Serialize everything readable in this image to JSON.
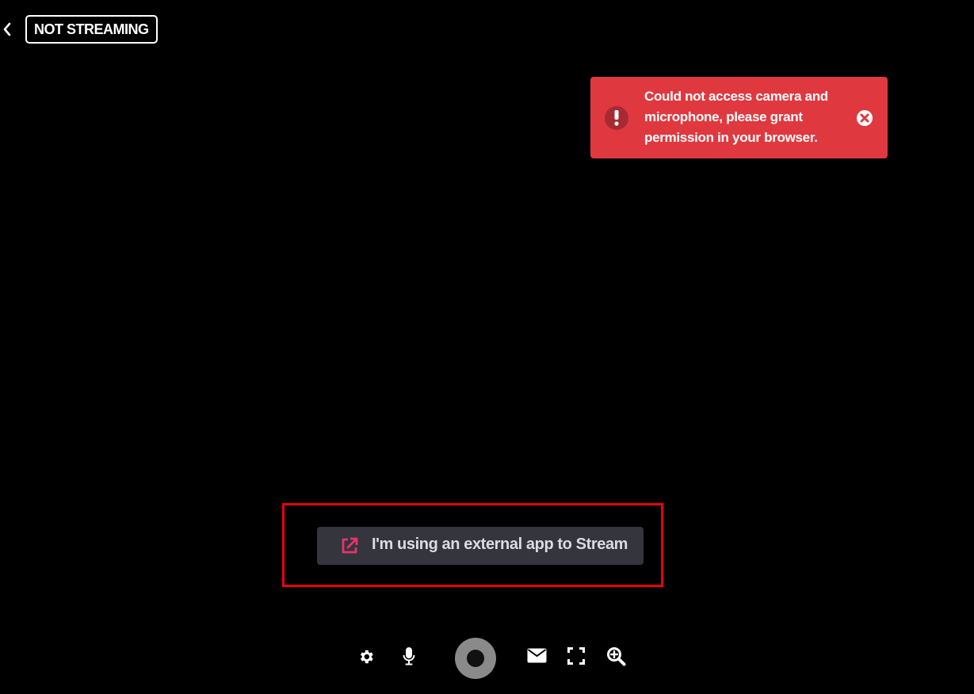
{
  "header": {
    "status_label": "NOT STREAMING",
    "back_icon": "chevron-left-icon"
  },
  "toast": {
    "message": "Could not access camera and microphone, please grant permission in your browser.",
    "background": "#e0383f",
    "icon": "exclamation-circle-icon",
    "close_icon": "close-circle-icon"
  },
  "external_app": {
    "label": "I'm using an external app to Stream",
    "icon": "external-link-icon",
    "icon_color": "#e8336e",
    "highlight_color": "#e8000b"
  },
  "controls": {
    "items": [
      "settings-icon",
      "microphone-icon",
      "record-button",
      "message-icon",
      "fullscreen-icon",
      "zoom-in-icon"
    ]
  }
}
